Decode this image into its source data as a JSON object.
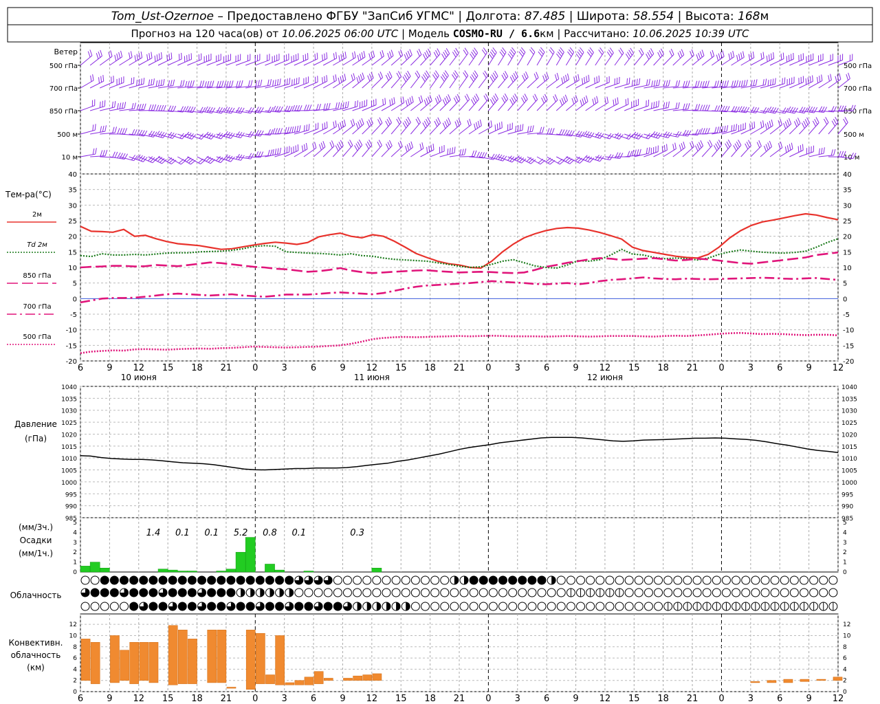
{
  "header": {
    "station": "Tom_Ust-Ozernoe",
    "provider": " – Предоставлено ФГБУ \"ЗапСиб УГМС\" | Долгота: ",
    "lon": "87.485",
    "lat_label": " | Широта: ",
    "lat": "58.554",
    "alt_label": " | Высота: ",
    "alt": "168",
    "alt_unit": "м",
    "forecast_prefix": "Прогноз на 120 часа(ов) от ",
    "forecast_start": "10.06.2025 06:00 UTC",
    "model_label": " | Модель ",
    "model": "COSMO-RU / 6.6",
    "model_unit": "км",
    "calc_label": " | Рассчитано: ",
    "calc_time": "10.06.2025 10:39 UTC"
  },
  "wind_panel": {
    "title": "Ветер",
    "levels": [
      "500 гПа",
      "700 гПа",
      "850 гПа",
      "500 м",
      "10  м"
    ],
    "color": "#8a2be2"
  },
  "temp_panel": {
    "title": "Тем-ра(°С)",
    "legend": [
      {
        "label": "2м",
        "color": "#e8322c",
        "dash": "solid"
      },
      {
        "label": "Td  2м",
        "color": "#1a7a1a",
        "dash": "dotted"
      },
      {
        "label": "850 гПа",
        "color": "#e0147a",
        "dash": "long"
      },
      {
        "label": "700 гПа",
        "color": "#e0147a",
        "dash": "dashdot"
      },
      {
        "label": "500 гПа",
        "color": "#e0147a",
        "dash": "dotted"
      }
    ],
    "yticks": [
      "40",
      "35",
      "30",
      "25",
      "20",
      "15",
      "10",
      "5",
      "0",
      "-5",
      "-10",
      "-15",
      "-20"
    ]
  },
  "time_axis": {
    "hours": [
      "6",
      "9",
      "12",
      "15",
      "18",
      "21",
      "0",
      "3",
      "6",
      "9",
      "12",
      "15",
      "18",
      "21",
      "0",
      "3",
      "6",
      "9",
      "12",
      "15",
      "18",
      "21",
      "0",
      "3",
      "6",
      "9",
      "12"
    ],
    "dates": [
      "10 июня",
      "11 июня",
      "12 июня"
    ]
  },
  "pressure_panel": {
    "title": "Давление",
    "unit": "(гПа)",
    "yticks": [
      "1040",
      "1035",
      "1030",
      "1025",
      "1020",
      "1015",
      "1010",
      "1005",
      "1000",
      "995",
      "990",
      "985"
    ]
  },
  "precip_panel": {
    "unit_top": "(мм/3ч.)",
    "title": "Осадки",
    "unit_bottom": "(мм/1ч.)",
    "yticks": [
      "5",
      "4",
      "3",
      "2",
      "1",
      "0"
    ],
    "totals": [
      {
        "hour": 7.5,
        "text": "1.4"
      },
      {
        "hour": 10.5,
        "text": "0.1"
      },
      {
        "hour": 13.5,
        "text": "0.1"
      },
      {
        "hour": 16.5,
        "text": "5.2"
      },
      {
        "hour": 19.5,
        "text": "0.8"
      },
      {
        "hour": 22.5,
        "text": "0.1"
      },
      {
        "hour": 28.5,
        "text": "0.3"
      }
    ],
    "color": "#22cc22"
  },
  "cloud_panel": {
    "title": "Облачность"
  },
  "conv_panel": {
    "title_lines": [
      "Конвективн.",
      "облачность",
      "(км)"
    ],
    "yticks": [
      "12",
      "10",
      "8",
      "6",
      "4",
      "2",
      "0"
    ],
    "color": "#f08a30"
  },
  "chart_data": {
    "type": "line",
    "time_hours_from_start_at_06UTC_10Jun": [
      0,
      1,
      2,
      3,
      4,
      5,
      6,
      7,
      8,
      9,
      10,
      11,
      12,
      13,
      14,
      15,
      16,
      17,
      18,
      19,
      20,
      21,
      22,
      23,
      24,
      25,
      26,
      27,
      28,
      29,
      30,
      31,
      32,
      33,
      34,
      35,
      36,
      37,
      38,
      39,
      40,
      41,
      42,
      43,
      44,
      45,
      46,
      47,
      48,
      49,
      50,
      51,
      52,
      53,
      54,
      55,
      56,
      57,
      58,
      59,
      60,
      61,
      62,
      63,
      64,
      65,
      66,
      67,
      68,
      69,
      70,
      71,
      72,
      73,
      74,
      75,
      76,
      77,
      78
    ],
    "series": [
      {
        "name": "2м",
        "values": [
          23.2,
          21.6,
          21.5,
          21.3,
          22.2,
          20.0,
          20.3,
          19.2,
          18.3,
          17.6,
          17.3,
          17.0,
          16.4,
          15.8,
          16.0,
          16.6,
          17.2,
          17.7,
          18.1,
          17.8,
          17.4,
          18.0,
          19.8,
          20.5,
          21.0,
          20.0,
          19.5,
          20.5,
          20.0,
          18.4,
          16.5,
          14.5,
          13.2,
          12.0,
          11.2,
          10.8,
          10.0,
          9.8,
          12.0,
          15.0,
          17.5,
          19.5,
          20.8,
          21.8,
          22.5,
          22.8,
          22.6,
          22.0,
          21.2,
          20.2,
          19.1,
          16.5,
          15.4,
          14.8,
          14.2,
          13.6,
          13.2,
          13.0,
          14.2,
          16.5,
          19.5,
          21.8,
          23.5,
          24.6,
          25.2,
          25.9,
          26.6,
          27.2,
          26.8,
          26.0,
          25.3
        ]
      },
      {
        "name": "Td  2м",
        "values": [
          13.8,
          13.5,
          14.4,
          14.0,
          14.0,
          14.2,
          14.0,
          14.3,
          14.6,
          14.7,
          14.7,
          15.0,
          15.1,
          15.2,
          15.5,
          16.0,
          16.7,
          17.0,
          16.8,
          15.0,
          14.8,
          14.6,
          14.5,
          14.3,
          14.0,
          14.4,
          13.8,
          13.6,
          13.0,
          12.6,
          12.4,
          12.2,
          12.0,
          11.5,
          11.0,
          10.4,
          10.0,
          10.2,
          11.0,
          12.0,
          12.5,
          11.5,
          10.5,
          10.0,
          9.8,
          10.8,
          12.2,
          12.0,
          12.5,
          14.0,
          15.8,
          14.3,
          14.0,
          13.2,
          12.8,
          13.0,
          12.8,
          12.4,
          13.0,
          14.2,
          15.0,
          15.6,
          15.2,
          14.9,
          14.7,
          14.6,
          14.8,
          15.2,
          16.5,
          18.0,
          19.2
        ]
      },
      {
        "name": "850 гПа",
        "values": [
          10.0,
          10.2,
          10.3,
          10.5,
          10.5,
          10.3,
          10.4,
          10.8,
          10.6,
          10.4,
          10.8,
          11.2,
          11.6,
          11.4,
          11.0,
          10.6,
          10.2,
          10.0,
          9.6,
          9.4,
          9.0,
          8.6,
          8.8,
          9.2,
          9.8,
          9.0,
          8.5,
          8.2,
          8.4,
          8.6,
          8.8,
          9.0,
          9.1,
          8.8,
          8.6,
          8.4,
          8.5,
          8.6,
          8.5,
          8.3,
          8.2,
          8.4,
          9.2,
          10.2,
          10.8,
          11.5,
          12.0,
          12.6,
          13.0,
          12.8,
          12.4,
          12.6,
          12.8,
          13.0,
          12.6,
          12.2,
          12.4,
          12.8,
          12.6,
          12.2,
          11.8,
          11.4,
          11.2,
          11.6,
          12.0,
          12.4,
          12.8,
          13.2,
          14.0,
          14.4,
          14.8
        ]
      },
      {
        "name": "700 гПа",
        "values": [
          -1.2,
          -0.6,
          0.0,
          0.2,
          0.2,
          0.3,
          0.6,
          1.0,
          1.4,
          1.6,
          1.4,
          1.2,
          1.0,
          1.2,
          1.4,
          1.0,
          0.8,
          0.6,
          0.9,
          1.3,
          1.3,
          1.3,
          1.5,
          1.8,
          2.0,
          1.8,
          1.6,
          1.4,
          1.8,
          2.5,
          3.2,
          3.8,
          4.2,
          4.4,
          4.6,
          4.8,
          5.0,
          5.3,
          5.6,
          5.4,
          5.2,
          5.0,
          4.7,
          4.6,
          4.8,
          5.0,
          4.6,
          5.0,
          5.6,
          6.0,
          6.2,
          6.5,
          6.8,
          6.5,
          6.3,
          6.2,
          6.4,
          6.3,
          6.2,
          6.3,
          6.4,
          6.5,
          6.6,
          6.7,
          6.6,
          6.4,
          6.3,
          6.5,
          6.6,
          6.3,
          6.0
        ]
      },
      {
        "name": "500 гПа",
        "values": [
          -17.5,
          -17.0,
          -16.8,
          -16.6,
          -16.7,
          -16.3,
          -16.2,
          -16.3,
          -16.4,
          -16.2,
          -16.1,
          -16.0,
          -16.1,
          -15.9,
          -15.8,
          -15.6,
          -15.4,
          -15.5,
          -15.6,
          -15.7,
          -15.6,
          -15.5,
          -15.4,
          -15.2,
          -15.0,
          -14.5,
          -13.8,
          -13.0,
          -12.6,
          -12.4,
          -12.3,
          -12.4,
          -12.3,
          -12.2,
          -12.1,
          -12.0,
          -12.1,
          -12.0,
          -11.9,
          -12.0,
          -12.1,
          -12.1,
          -12.1,
          -12.2,
          -12.1,
          -12.0,
          -12.1,
          -12.2,
          -12.1,
          -12.0,
          -12.0,
          -12.0,
          -12.1,
          -12.2,
          -12.0,
          -11.9,
          -12.0,
          -11.8,
          -11.6,
          -11.3,
          -11.1,
          -11.0,
          -11.2,
          -11.4,
          -11.3,
          -11.4,
          -11.6,
          -11.7,
          -11.6,
          -11.6,
          -11.8
        ]
      },
      {
        "name": "Давление",
        "values": [
          1011.0,
          1010.8,
          1010.2,
          1009.8,
          1009.6,
          1009.4,
          1009.4,
          1009.2,
          1008.8,
          1008.4,
          1008.0,
          1007.8,
          1007.6,
          1007.2,
          1006.6,
          1006.0,
          1005.4,
          1005.1,
          1005.0,
          1005.2,
          1005.4,
          1005.6,
          1005.6,
          1005.8,
          1005.8,
          1005.8,
          1006.0,
          1006.4,
          1006.9,
          1007.4,
          1007.8,
          1008.6,
          1009.2,
          1010.0,
          1010.8,
          1011.6,
          1012.6,
          1013.6,
          1014.4,
          1015.0,
          1015.6,
          1016.4,
          1016.9,
          1017.4,
          1017.9,
          1018.4,
          1018.6,
          1018.6,
          1018.6,
          1018.4,
          1018.0,
          1017.6,
          1017.2,
          1017.0,
          1017.2,
          1017.5,
          1017.6,
          1017.7,
          1017.9,
          1018.1,
          1018.3,
          1018.3,
          1018.4,
          1018.3,
          1018.0,
          1017.8,
          1017.4,
          1016.8,
          1016.0,
          1015.4,
          1014.6,
          1013.8,
          1013.2,
          1012.8,
          1012.3
        ]
      }
    ],
    "precip_1h": [
      0.6,
      1.0,
      0.4,
      0,
      0,
      0,
      0,
      0,
      0.3,
      0.2,
      0.1,
      0.1,
      0,
      0,
      0.1,
      0.3,
      2.0,
      3.5,
      0,
      0.8,
      0.2,
      0,
      0,
      0.1,
      0,
      0,
      0,
      0,
      0,
      0,
      0.4
    ],
    "conv_cloud_km": [
      [
        2.0,
        9.4
      ],
      [
        1.4,
        8.8
      ],
      [
        1.4,
        1.4
      ],
      [
        1.6,
        10.0
      ],
      [
        2.0,
        7.4
      ],
      [
        1.4,
        8.8
      ],
      [
        2.0,
        8.8
      ],
      [
        1.6,
        8.8
      ],
      [
        1.2,
        1.2
      ],
      [
        1.2,
        11.8
      ],
      [
        1.4,
        11.0
      ],
      [
        1.4,
        9.4
      ],
      [
        0,
        0
      ],
      [
        1.6,
        11.0
      ],
      [
        1.6,
        11.0
      ],
      [
        0.6,
        0.8
      ],
      [
        0,
        0
      ],
      [
        0.4,
        11.0
      ],
      [
        1.4,
        10.4
      ],
      [
        1.4,
        3.0
      ],
      [
        1.2,
        10.0
      ],
      [
        1.2,
        1.6
      ],
      [
        1.2,
        2.0
      ],
      [
        1.2,
        2.6
      ],
      [
        1.4,
        3.6
      ],
      [
        2.0,
        2.4
      ],
      [
        2.0,
        2.0
      ],
      [
        2.0,
        2.4
      ],
      [
        2.0,
        2.8
      ],
      [
        2.0,
        3.0
      ],
      [
        2.0,
        3.2
      ]
    ],
    "conv_cloud_late_km": [
      [
        1.6,
        1.8
      ],
      [
        1.6,
        2.0
      ],
      [
        1.6,
        2.2
      ],
      [
        1.8,
        2.2
      ],
      [
        2.0,
        2.2
      ],
      [
        2.0,
        2.6
      ]
    ]
  }
}
